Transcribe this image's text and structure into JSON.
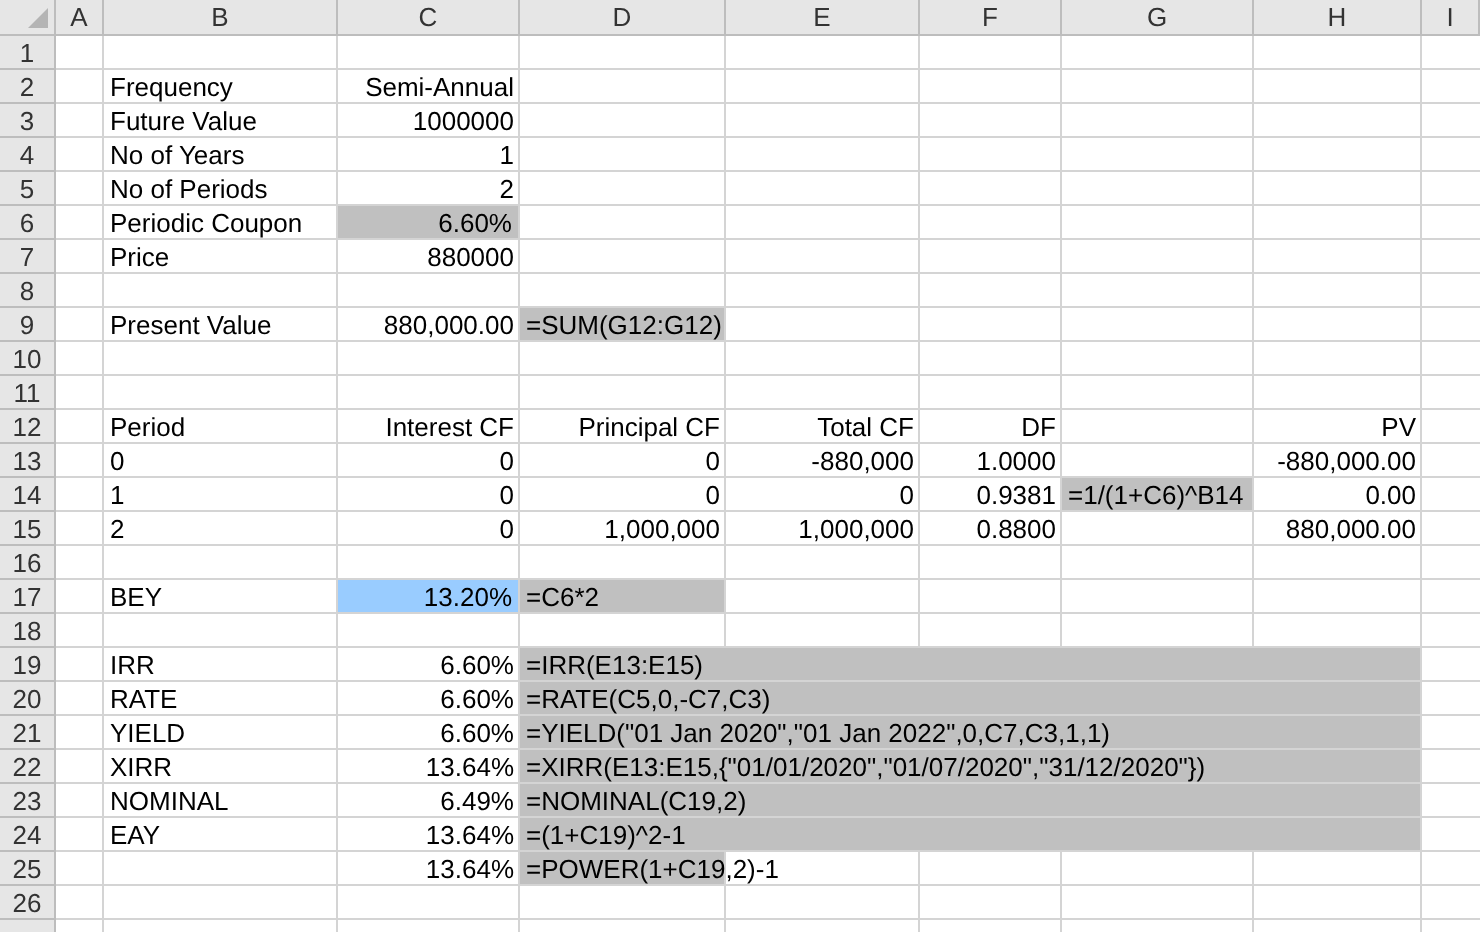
{
  "sheet": {
    "columns": [
      "A",
      "B",
      "C",
      "D",
      "E",
      "F",
      "G",
      "H",
      "I"
    ],
    "rows": [
      {
        "number": "1"
      },
      {
        "number": "2",
        "cells": {
          "B": {
            "text": "Frequency",
            "kind": "text"
          },
          "C": {
            "text": "Semi-Annual",
            "kind": "value"
          }
        }
      },
      {
        "number": "3",
        "cells": {
          "B": {
            "text": "Future Value",
            "kind": "text"
          },
          "C": {
            "text": "1000000",
            "kind": "value"
          }
        }
      },
      {
        "number": "4",
        "cells": {
          "B": {
            "text": "No of Years",
            "kind": "text"
          },
          "C": {
            "text": "1",
            "kind": "value"
          }
        }
      },
      {
        "number": "5",
        "cells": {
          "B": {
            "text": "No of Periods",
            "kind": "text"
          },
          "C": {
            "text": "2",
            "kind": "value"
          }
        }
      },
      {
        "number": "6",
        "cells": {
          "B": {
            "text": "Periodic Coupon",
            "kind": "text"
          },
          "C": {
            "text": "6.60%",
            "kind": "value",
            "color": "#c0c0c0"
          }
        }
      },
      {
        "number": "7",
        "cells": {
          "B": {
            "text": "Price",
            "kind": "text"
          },
          "C": {
            "text": "880000",
            "kind": "value"
          }
        }
      },
      {
        "number": "8"
      },
      {
        "number": "9",
        "cells": {
          "B": {
            "text": "Present Value",
            "kind": "text"
          },
          "C": {
            "text": "880,000.00",
            "kind": "value"
          },
          "D": {
            "text": "=SUM(G12:G12)",
            "kind": "text",
            "color": "#c0c0c0"
          }
        }
      },
      {
        "number": "10"
      },
      {
        "number": "11"
      },
      {
        "number": "12",
        "cells": {
          "B": {
            "text": "Period",
            "kind": "text"
          },
          "C": {
            "text": "Interest CF",
            "kind": "value"
          },
          "D": {
            "text": "Principal CF",
            "kind": "value"
          },
          "E": {
            "text": "Total CF",
            "kind": "value"
          },
          "F": {
            "text": "DF",
            "kind": "value"
          },
          "H": {
            "text": "PV",
            "kind": "value"
          }
        }
      },
      {
        "number": "13",
        "cells": {
          "B": {
            "text": "0",
            "kind": "text"
          },
          "C": {
            "text": "0",
            "kind": "value"
          },
          "D": {
            "text": "0",
            "kind": "value"
          },
          "E": {
            "text": "-880,000",
            "kind": "value"
          },
          "F": {
            "text": "1.0000",
            "kind": "value"
          },
          "H": {
            "text": "-880,000.00",
            "kind": "value"
          }
        }
      },
      {
        "number": "14",
        "cells": {
          "B": {
            "text": "1",
            "kind": "text"
          },
          "C": {
            "text": "0",
            "kind": "value"
          },
          "D": {
            "text": "0",
            "kind": "value"
          },
          "E": {
            "text": "0",
            "kind": "value"
          },
          "F": {
            "text": "0.9381",
            "kind": "value"
          },
          "G": {
            "text": "=1/(1+C6)^B14",
            "kind": "text",
            "color": "#c0c0c0"
          },
          "H": {
            "text": "0.00",
            "kind": "value"
          }
        }
      },
      {
        "number": "15",
        "cells": {
          "B": {
            "text": "2",
            "kind": "text"
          },
          "C": {
            "text": "0",
            "kind": "value"
          },
          "D": {
            "text": "1,000,000",
            "kind": "value"
          },
          "E": {
            "text": "1,000,000",
            "kind": "value"
          },
          "F": {
            "text": "0.8800",
            "kind": "value"
          },
          "H": {
            "text": "880,000.00",
            "kind": "value"
          }
        }
      },
      {
        "number": "16"
      },
      {
        "number": "17",
        "cells": {
          "B": {
            "text": "BEY",
            "kind": "text"
          },
          "C": {
            "text": "13.20%",
            "kind": "value",
            "color": "#99ccff"
          },
          "D": {
            "text": "=C6*2",
            "kind": "text",
            "color": "#c0c0c0"
          }
        }
      },
      {
        "number": "18"
      },
      {
        "number": "19",
        "cells": {
          "B": {
            "text": "IRR",
            "kind": "text"
          },
          "C": {
            "text": "6.60%",
            "kind": "value"
          },
          "D": {
            "text": "=IRR(E13:E15)",
            "kind": "text",
            "color": "#c0c0c0"
          },
          "E": {
            "color": "#c0c0c0"
          },
          "F": {
            "color": "#c0c0c0"
          },
          "G": {
            "color": "#c0c0c0"
          },
          "H": {
            "color": "#c0c0c0"
          }
        }
      },
      {
        "number": "20",
        "cells": {
          "B": {
            "text": "RATE",
            "kind": "text"
          },
          "C": {
            "text": "6.60%",
            "kind": "value"
          },
          "D": {
            "text": "=RATE(C5,0,-C7,C3)",
            "kind": "text",
            "color": "#c0c0c0"
          },
          "E": {
            "color": "#c0c0c0"
          },
          "F": {
            "color": "#c0c0c0"
          },
          "G": {
            "color": "#c0c0c0"
          },
          "H": {
            "color": "#c0c0c0"
          }
        }
      },
      {
        "number": "21",
        "cells": {
          "B": {
            "text": "YIELD",
            "kind": "text"
          },
          "C": {
            "text": "6.60%",
            "kind": "value"
          },
          "D": {
            "text": "=YIELD(\"01 Jan 2020\",\"01 Jan 2022\",0,C7,C3,1,1)",
            "kind": "text",
            "color": "#c0c0c0"
          },
          "E": {
            "color": "#c0c0c0"
          },
          "F": {
            "color": "#c0c0c0"
          },
          "G": {
            "color": "#c0c0c0"
          },
          "H": {
            "color": "#c0c0c0"
          }
        }
      },
      {
        "number": "22",
        "cells": {
          "B": {
            "text": "XIRR",
            "kind": "text"
          },
          "C": {
            "text": "13.64%",
            "kind": "value"
          },
          "D": {
            "text": "=XIRR(E13:E15,{\"01/01/2020\",\"01/07/2020\",\"31/12/2020\"})",
            "kind": "text",
            "color": "#c0c0c0"
          },
          "E": {
            "color": "#c0c0c0"
          },
          "F": {
            "color": "#c0c0c0"
          },
          "G": {
            "color": "#c0c0c0"
          },
          "H": {
            "color": "#c0c0c0"
          }
        }
      },
      {
        "number": "23",
        "cells": {
          "B": {
            "text": "NOMINAL",
            "kind": "text"
          },
          "C": {
            "text": "6.49%",
            "kind": "value"
          },
          "D": {
            "text": "=NOMINAL(C19,2)",
            "kind": "text",
            "color": "#c0c0c0"
          },
          "E": {
            "color": "#c0c0c0"
          },
          "F": {
            "color": "#c0c0c0"
          },
          "G": {
            "color": "#c0c0c0"
          },
          "H": {
            "color": "#c0c0c0"
          }
        }
      },
      {
        "number": "24",
        "cells": {
          "B": {
            "text": "EAY",
            "kind": "text"
          },
          "C": {
            "text": "13.64%",
            "kind": "value"
          },
          "D": {
            "text": "=(1+C19)^2-1",
            "kind": "text",
            "color": "#c0c0c0"
          },
          "E": {
            "color": "#c0c0c0"
          },
          "F": {
            "color": "#c0c0c0"
          },
          "G": {
            "color": "#c0c0c0"
          },
          "H": {
            "color": "#c0c0c0"
          }
        }
      },
      {
        "number": "25",
        "cells": {
          "C": {
            "text": "13.64%",
            "kind": "value"
          },
          "D": {
            "text": "=POWER(1+C19,2)-1",
            "kind": "text",
            "color": "#c0c0c0"
          }
        }
      },
      {
        "number": "26"
      }
    ]
  }
}
